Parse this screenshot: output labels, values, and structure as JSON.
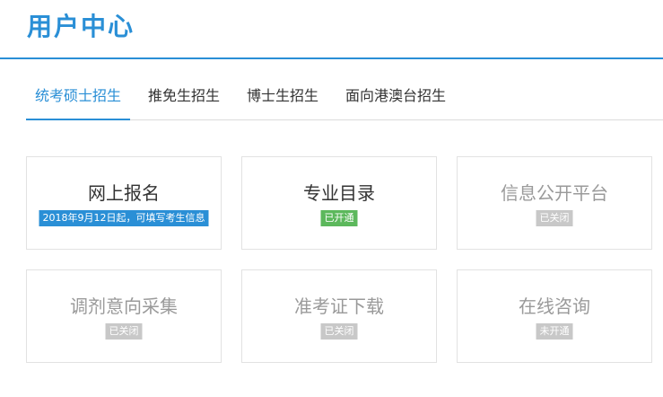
{
  "header": {
    "title": "用户中心"
  },
  "tabs": [
    {
      "label": "统考硕士招生",
      "active": true
    },
    {
      "label": "推免生招生",
      "active": false
    },
    {
      "label": "博士生招生",
      "active": false
    },
    {
      "label": "面向港澳台招生",
      "active": false
    }
  ],
  "cards": [
    {
      "title": "网上报名",
      "badge": "2018年9月12日起，可填写考生信息",
      "badge_color": "#2a8fd6",
      "enabled": true
    },
    {
      "title": "专业目录",
      "badge": "已开通",
      "badge_color": "#5cb85c",
      "enabled": true
    },
    {
      "title": "信息公开平台",
      "badge": "已关闭",
      "badge_color": "#c8c8c8",
      "enabled": false
    },
    {
      "title": "调剂意向采集",
      "badge": "已关闭",
      "badge_color": "#c8c8c8",
      "enabled": false
    },
    {
      "title": "准考证下载",
      "badge": "已关闭",
      "badge_color": "#c8c8c8",
      "enabled": false
    },
    {
      "title": "在线咨询",
      "badge": "未开通",
      "badge_color": "#c8c8c8",
      "enabled": false
    }
  ],
  "colors": {
    "accent": "#2a8fd6",
    "success": "#5cb85c",
    "muted": "#c8c8c8"
  }
}
